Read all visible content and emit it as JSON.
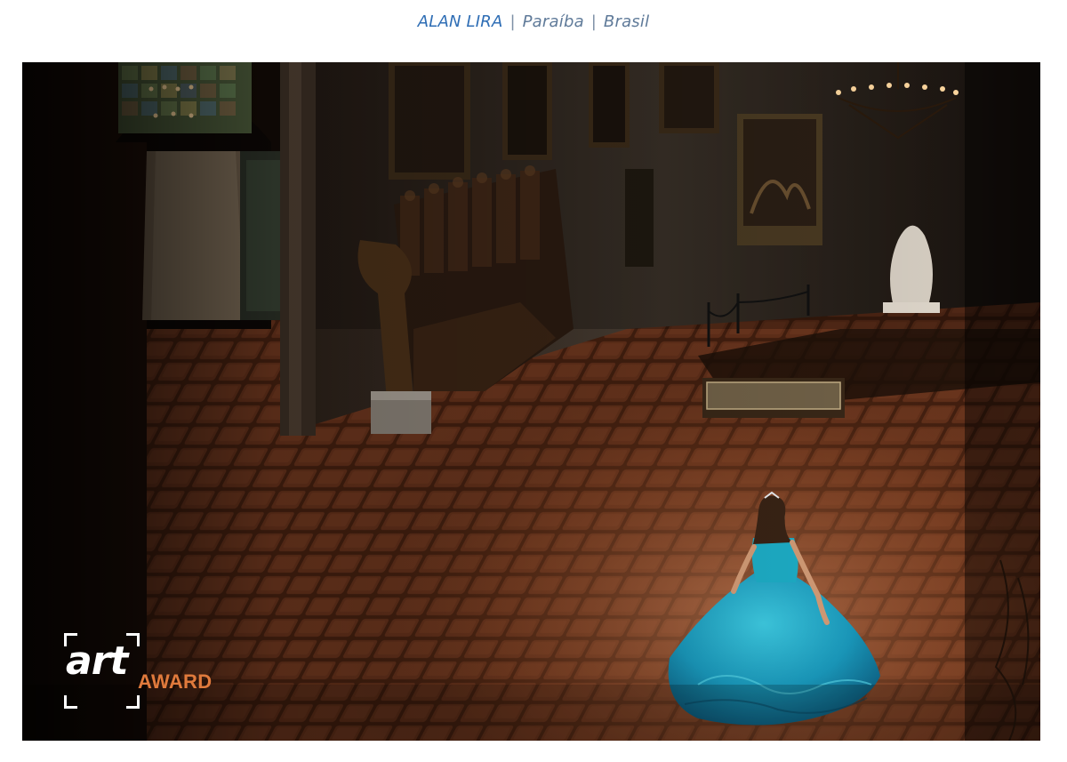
{
  "caption": {
    "name": "ALAN LIRA",
    "separator": "|",
    "region": "Paraíba",
    "country": "Brasil"
  },
  "logo": {
    "art": "art",
    "award": "AWARD",
    "accent_color": "#e07a3c"
  },
  "photo": {
    "scene": "Woman in a flowing turquoise ball gown twirling in a dim, ornate baroque hall with tiled floor, paintings and chandeliers"
  }
}
